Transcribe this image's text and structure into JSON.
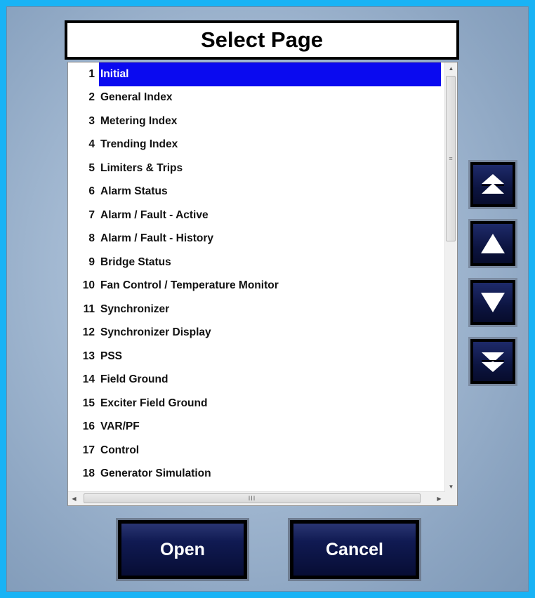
{
  "dialog": {
    "title": "Select Page"
  },
  "pages": [
    {
      "num": "1",
      "label": "Initial",
      "selected": true
    },
    {
      "num": "2",
      "label": "General Index"
    },
    {
      "num": "3",
      "label": "Metering Index"
    },
    {
      "num": "4",
      "label": "Trending Index"
    },
    {
      "num": "5",
      "label": "Limiters & Trips"
    },
    {
      "num": "6",
      "label": "Alarm Status"
    },
    {
      "num": "7",
      "label": "Alarm / Fault - Active"
    },
    {
      "num": "8",
      "label": "Alarm / Fault - History"
    },
    {
      "num": "9",
      "label": "Bridge Status"
    },
    {
      "num": "10",
      "label": "Fan Control / Temperature Monitor"
    },
    {
      "num": "11",
      "label": "Synchronizer"
    },
    {
      "num": "12",
      "label": "Synchronizer Display"
    },
    {
      "num": "13",
      "label": "PSS"
    },
    {
      "num": "14",
      "label": "Field Ground"
    },
    {
      "num": "15",
      "label": "Exciter Field Ground"
    },
    {
      "num": "16",
      "label": "VAR/PF"
    },
    {
      "num": "17",
      "label": "Control"
    },
    {
      "num": "18",
      "label": "Generator Simulation"
    }
  ],
  "buttons": {
    "open_label": "Open",
    "cancel_label": "Cancel"
  },
  "nav_icons": {
    "top": "double-up-arrow-icon",
    "up": "up-arrow-icon",
    "down": "down-arrow-icon",
    "bottom": "double-down-arrow-icon"
  },
  "colors": {
    "frame": "#19b3f5",
    "selection": "#0a0af0",
    "button_face": "#0c1440"
  }
}
